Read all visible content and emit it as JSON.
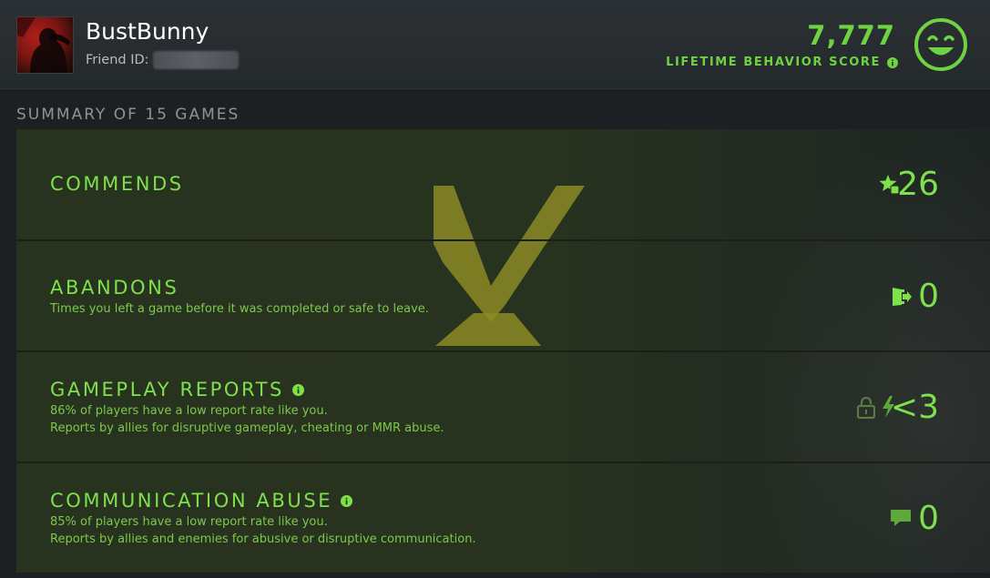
{
  "header": {
    "player_name": "BustBunny",
    "friend_id_label": "Friend ID:",
    "friend_id_value": "",
    "score_value": "7,777",
    "score_label": "LIFETIME BEHAVIOR SCORE",
    "score_mood_icon": "smiling-face-icon"
  },
  "summary": {
    "title": "SUMMARY OF 15 GAMES"
  },
  "rows": [
    {
      "title": "COMMENDS",
      "lines": [],
      "value": "26",
      "icon": "star-thumbs-up-icon",
      "has_info": false
    },
    {
      "title": "ABANDONS",
      "lines": [
        "Times you left a game before it was completed or safe to leave."
      ],
      "value": "0",
      "icon": "exit-door-icon",
      "has_info": false
    },
    {
      "title": "GAMEPLAY REPORTS",
      "lines": [
        "86% of players have a low report rate like you.",
        "Reports by allies for disruptive gameplay, cheating or MMR abuse."
      ],
      "value": "<3",
      "icon": "lightning-icon",
      "secondary_icon": "padlock-icon",
      "has_info": true
    },
    {
      "title": "COMMUNICATION ABUSE",
      "lines": [
        "85% of players have a low report rate like you.",
        "Reports by allies and enemies for abusive or disruptive communication."
      ],
      "value": "0",
      "icon": "speech-bubble-icon",
      "has_info": true
    }
  ],
  "colors": {
    "accent_green": "#7ee04a",
    "score_green": "#6fd341",
    "background": "#1c2023",
    "watermark_gold": "#9c9a26"
  }
}
